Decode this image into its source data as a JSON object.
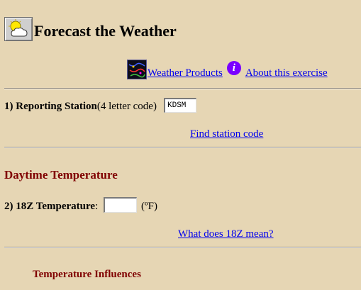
{
  "title": "Forecast the Weather",
  "icons": {
    "title": "sun-cloud-icon",
    "weather_products": "weather-map-icon",
    "about": "info-icon"
  },
  "links": {
    "weather_products": "Weather Products",
    "about": "About this exercise",
    "find_station": "Find station code",
    "what_18z": "What does 18Z mean?"
  },
  "info_glyph": "i",
  "station": {
    "label": "1) Reporting Station",
    "hint": "(4 letter code)",
    "value": "KDSM"
  },
  "daytime": {
    "heading": "Daytime Temperature",
    "temp_label": "2) 18Z Temperature",
    "colon": ":",
    "temp_value": "",
    "unit": "(ºF)"
  },
  "influences": {
    "heading": "Temperature Influences"
  },
  "colors": {
    "background": "#e6d6b4",
    "link": "#0000ee",
    "heading": "#800000"
  }
}
